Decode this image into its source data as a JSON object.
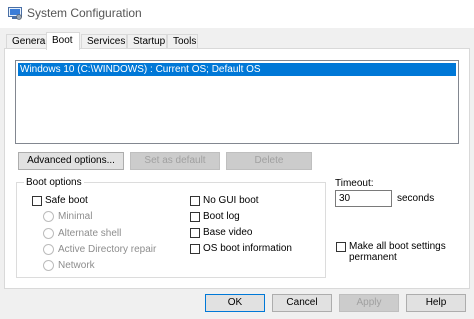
{
  "window": {
    "title": "System Configuration"
  },
  "tabs": [
    {
      "label": "General"
    },
    {
      "label": "Boot"
    },
    {
      "label": "Services"
    },
    {
      "label": "Startup"
    },
    {
      "label": "Tools"
    }
  ],
  "os_list": {
    "items": [
      "Windows 10 (C:\\WINDOWS) : Current OS; Default OS"
    ]
  },
  "actions": {
    "advanced_options": "Advanced options...",
    "set_as_default": "Set as default",
    "delete": "Delete"
  },
  "boot_options": {
    "group_label": "Boot options",
    "safe_boot": "Safe boot",
    "minimal": "Minimal",
    "alternate_shell": "Alternate shell",
    "active_directory_repair": "Active Directory repair",
    "network": "Network",
    "no_gui_boot": "No GUI boot",
    "boot_log": "Boot log",
    "base_video": "Base video",
    "os_boot_information": "OS boot information"
  },
  "timeout": {
    "label": "Timeout:",
    "value": "30",
    "unit": "seconds"
  },
  "make_permanent": {
    "label": "Make all boot settings permanent"
  },
  "footer": {
    "ok": "OK",
    "cancel": "Cancel",
    "apply": "Apply",
    "help": "Help"
  },
  "colors": {
    "selection": "#0078d7",
    "window_bg": "#f0f0f0",
    "panel_bg": "#ffffff"
  },
  "icons": {
    "app": "system-configuration-icon"
  }
}
